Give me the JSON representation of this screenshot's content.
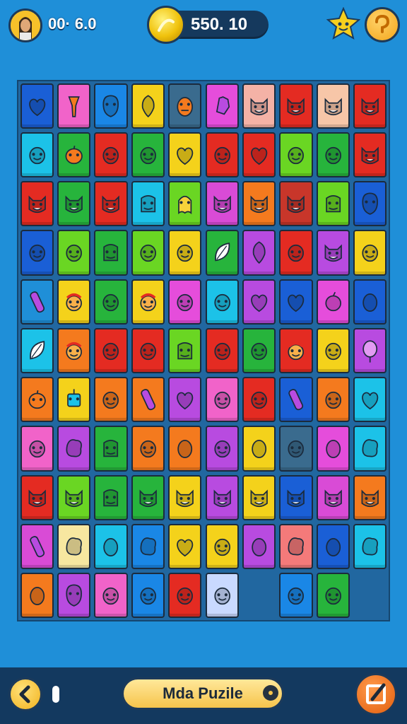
{
  "header": {
    "timer": "00· 6.0",
    "score": "550. 10"
  },
  "footer": {
    "title": "Mda Puzile"
  },
  "icons": {
    "avatar": "avatar-portrait-icon",
    "coin": "gold-coin-icon",
    "mascot": "star-mascot-icon",
    "hint": "hint-swirl-icon",
    "back": "back-chevron-icon",
    "edit": "pencil-edit-icon"
  },
  "colors": {
    "background": "#1f8fd8",
    "board": "#2167a0",
    "bar": "#13395f",
    "accent": "#f6c12a",
    "orange": "#e25e0e"
  },
  "board": {
    "columns": 10,
    "rows": 11,
    "tiles": [
      [
        "#1a5fd6:heart-icon",
        "#f163c9:torch-icon",
        "#1a87e6:alien-face-icon",
        "#f4d21b:shield-icon",
        "#3a6b8e:monkey-face-icon",
        "#e54ddb:hand-icon",
        "#f4b2a6:cat-face-icon",
        "#e42b22:devil-face-icon",
        "#f7c6a8:cat-face-icon",
        "#e42b22:cat-face-icon"
      ],
      [
        "#1cc2e8:face-icon",
        "#27b43c:pumpkin-icon",
        "#e42b22:face-icon",
        "#27b43c:face-icon",
        "#f4d21b:heart-icon",
        "#e42b22:face-icon",
        "#e42b22:heart-icon",
        "#6ad623:face-icon",
        "#27b43c:face-icon",
        "#e42b22:cat-face-icon"
      ],
      [
        "#e42b22:fox-face-icon",
        "#27b43c:fox-face-icon",
        "#e42b22:cat-face-icon",
        "#1cc2e8:frog-face-icon",
        "#6ad623:ghost-icon",
        "#d94bd6:cat-face-icon",
        "#f47a1e:cat-face-icon",
        "#c8362a:fox-face-icon",
        "#6ad623:monster-icon",
        "#1a5fd6:alien-face-icon"
      ],
      [
        "#1a5fd6:face-icon",
        "#6ad623:face-icon",
        "#27b43c:monster-icon",
        "#6ad623:face-icon",
        "#f4d21b:face-icon",
        "#27b43c:leaf-icon",
        "#b84be0:shield-icon",
        "#e42b22:face-icon",
        "#b84be0:cat-face-icon",
        "#f4d21b:face-icon"
      ],
      [
        "#1f8fd8:bar-icon",
        "#f4d21b:clown-face-icon",
        "#27b43c:face-icon",
        "#f4d21b:clown-face-icon",
        "#e54ddb:face-icon",
        "#1cc2e8:face-icon",
        "#b84be0:heart-icon",
        "#1a5fd6:heart-icon",
        "#e54ddb:apple-icon",
        "#1a5fd6:egg-icon"
      ],
      [
        "#1cc2e8:leaf-icon",
        "#f47a1e:clown-face-icon",
        "#e42b22:face-icon",
        "#e42b22:face-icon",
        "#6ad623:monster-icon",
        "#e42b22:face-icon",
        "#27b43c:face-icon",
        "#e42b22:clown-face-icon",
        "#f4d21b:face-icon",
        "#b84be0:balloon-icon"
      ],
      [
        "#f47a1e:pumpkin-icon",
        "#f4d21b:robot-icon",
        "#f47a1e:face-icon",
        "#f47a1e:bar-icon",
        "#b84be0:heart-icon",
        "#f163c9:face-icon",
        "#e42b22:face-icon",
        "#1a5fd6:bar-icon",
        "#f47a1e:face-icon",
        "#1cc2e8:heart-icon"
      ],
      [
        "#f163c9:face-icon",
        "#b84be0:blob-icon",
        "#27b43c:monster-icon",
        "#f47a1e:face-icon",
        "#f47a1e:egg-icon",
        "#b84be0:face-icon",
        "#f4d21b:egg-icon",
        "#3a6b8e:face-icon",
        "#e54ddb:egg-icon",
        "#1cc2e8:blob-icon"
      ],
      [
        "#e42b22:cat-face-icon",
        "#6ad623:cat-face-icon",
        "#27b43c:monster-icon",
        "#27b43c:cat-face-icon",
        "#f4d21b:cat-face-icon",
        "#b84be0:cat-face-icon",
        "#f4d21b:cat-face-icon",
        "#1a5fd6:cat-face-icon",
        "#d94bd6:cat-face-icon",
        "#f47a1e:cat-face-icon"
      ],
      [
        "#d94bd6:bar-icon",
        "#f7e7a0:blob-icon",
        "#1cc2e8:egg-icon",
        "#1a87e6:blob-icon",
        "#f4d21b:heart-icon",
        "#f4d21b:face-icon",
        "#b84be0:egg-icon",
        "#f47a7a:blob-icon",
        "#1a5fd6:egg-icon",
        "#1cc2e8:blob-icon"
      ],
      [
        "#f47a1e:egg-icon",
        "#b84be0:alien-face-icon",
        "#f163c9:face-icon",
        "#1a87e6:face-icon",
        "#e42b22:face-icon",
        "#c9d9ff:face-icon",
        "",
        "#1a87e6:face-icon",
        "#27b43c:face-icon",
        ""
      ]
    ]
  }
}
